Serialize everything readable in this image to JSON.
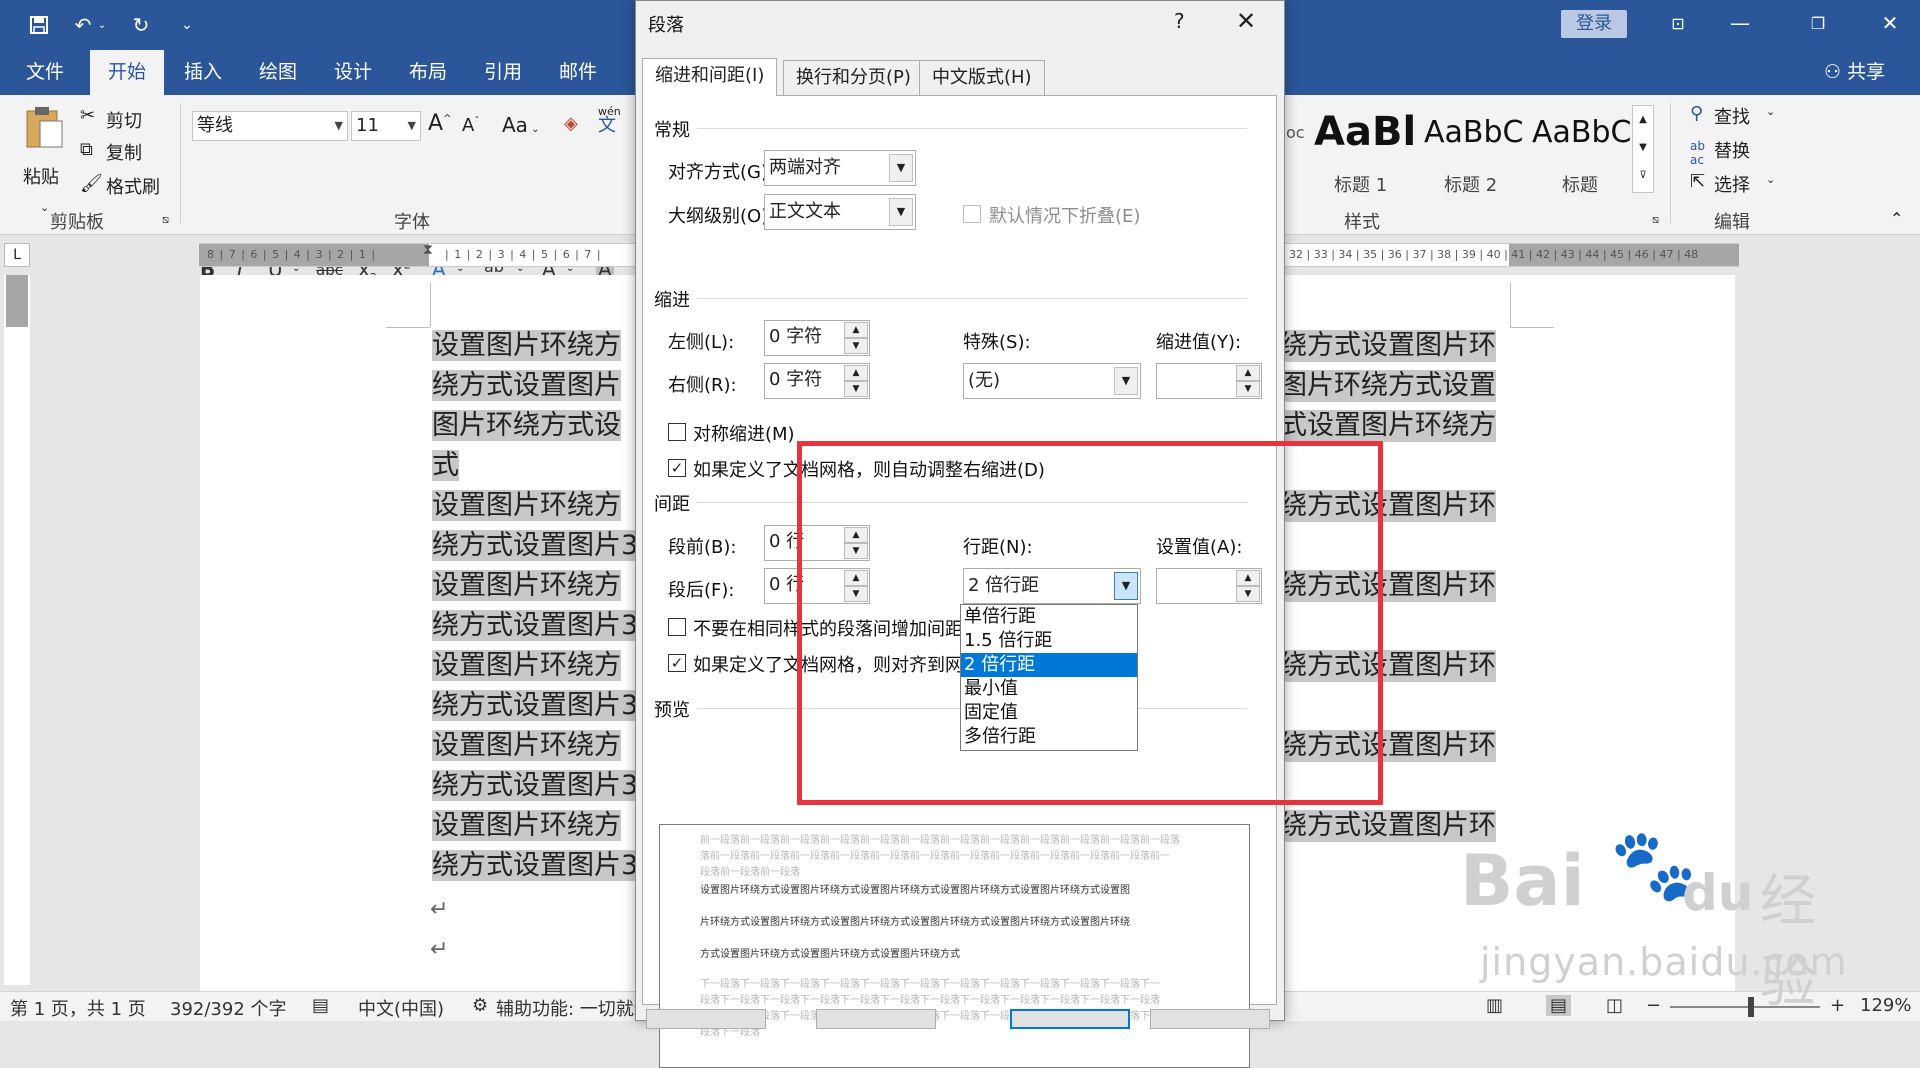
{
  "app": {
    "tabs": [
      "文件",
      "开始",
      "插入",
      "绘图",
      "设计",
      "布局",
      "引用",
      "邮件"
    ],
    "active_tab": "开始",
    "login": "登录",
    "share": "共享"
  },
  "ribbon": {
    "paste": "粘贴",
    "cut": "剪切",
    "copy": "复制",
    "format_painter": "格式刷",
    "clipboard_label": "剪贴板",
    "font_name": "等线",
    "font_size": "11",
    "font_label": "字体",
    "grow": "A",
    "shrink": "A",
    "aa": "Aa",
    "wen": "wén",
    "wen_char": "文",
    "styles": [
      {
        "preview": "AaBl",
        "name": "标题 1"
      },
      {
        "preview": "AaBbC",
        "name": "标题 2"
      },
      {
        "preview": "AaBbC",
        "name": "标题"
      }
    ],
    "style_partial": "oc",
    "styles_label": "样式",
    "find": "查找",
    "replace": "替换",
    "select": "选择",
    "edit_label": "编辑"
  },
  "ruler": {
    "left_marks": "8 | 7 | 6 | 5 | 4 | 3 | 2 | 1 |",
    "right_marks": "| 1 | 2 | 3 | 4 | 5 | 6 | 7 |",
    "far_right_marks": "32 | 33 | 34 | 35 | 36 | 37 | 38 | 39 | 40 | 41 | 42 | 43 | 44 | 45 | 46 | 47 | 48",
    "corner": "L"
  },
  "document": {
    "left_lines": [
      "设置图片环绕方",
      "绕方式设置图片",
      "图片环绕方式设",
      "式",
      "设置图片环绕方",
      "绕方式设置图片3",
      "设置图片环绕方",
      "绕方式设置图片3",
      "设置图片环绕方",
      "绕方式设置图片3",
      "设置图片环绕方",
      "绕方式设置图片3",
      "设置图片环绕方",
      "绕方式设置图片3"
    ],
    "right_lines": [
      "绕方式设置图片环",
      "图片环绕方式设置",
      "式设置图片环绕方",
      "",
      "绕方式设置图片环",
      "",
      "绕方式设置图片环",
      "",
      "绕方式设置图片环",
      "",
      "绕方式设置图片环",
      "",
      "绕方式设置图片环",
      ""
    ],
    "para_mark": "↵"
  },
  "status": {
    "page": "第 1 页，共 1 页",
    "words": "392/392 个字",
    "lang": "中文(中国)",
    "access": "辅助功能: 一切就绪",
    "zoom": "129%"
  },
  "dialog": {
    "title": "段落",
    "help": "?",
    "tabs": [
      "缩进和间距(I)",
      "换行和分页(P)",
      "中文版式(H)"
    ],
    "general": {
      "section": "常规",
      "align_label": "对齐方式(G):",
      "align_value": "两端对齐",
      "outline_label": "大纲级别(O):",
      "outline_value": "正文文本",
      "collapse_label": "默认情况下折叠(E)"
    },
    "indent": {
      "section": "缩进",
      "left_label": "左侧(L):",
      "left_value": "0 字符",
      "right_label": "右侧(R):",
      "right_value": "0 字符",
      "special_label": "特殊(S):",
      "special_value": "(无)",
      "by_label": "缩进值(Y):",
      "mirror_label": "对称缩进(M)",
      "auto_label": "如果定义了文档网格，则自动调整右缩进(D)"
    },
    "spacing": {
      "section": "间距",
      "before_label": "段前(B):",
      "before_value": "0 行",
      "after_label": "段后(F):",
      "after_value": "0 行",
      "line_label": "行距(N):",
      "line_value": "2 倍行距",
      "at_label": "设置值(A):",
      "nospace_label": "不要在相同样式的段落间增加间距(C)",
      "snap_label": "如果定义了文档网格，则对齐到网格(W)"
    },
    "line_options": [
      "单倍行距",
      "1.5 倍行距",
      "2 倍行距",
      "最小值",
      "固定值",
      "多倍行距"
    ],
    "line_selected_index": 2,
    "preview": {
      "section": "预览",
      "prev_lines": [
        "前一段落前一段落前一段落前一段落前一段落前一段落前一段落前一段落前一段落前一段落前一段落前一段落",
        "落前一段落前一段落前一段落前一段落前一段落前一段落前一段落前一段落前一段落前一段落前一段落前一",
        "段落前一段落前一段落"
      ],
      "sample_lines": [
        "设置图片环绕方式设置图片环绕方式设置图片环绕方式设置图片环绕方式设置图片环绕方式设置图",
        "片环绕方式设置图片环绕方式设置图片环绕方式设置图片环绕方式设置图片环绕方式设置图片环绕",
        "方式设置图片环绕方式设置图片环绕方式设置图片环绕方式"
      ],
      "next_lines": [
        "下一段落下一段落下一段落下一段落下一段落下一段落下一段落下一段落下一段落下一段落下一段落下一",
        "段落下一段落下一段落下一段落下一段落下一段落下一段落下一段落下一段落下一段落下一段落下一段落",
        "下一段落下一段落下一段落下一段落下一段落下一段落下一段落下一段落下一段落下一段落下一段落下一",
        "段落下一段落"
      ]
    }
  },
  "watermark": {
    "brand": "Bai",
    "brand2": "du",
    "cn": "经验",
    "url": "jingyan.baidu.com"
  },
  "colors": {
    "word_blue": "#2b579a",
    "highlight": "#0078d7",
    "annotation_red": "#e8323c"
  }
}
